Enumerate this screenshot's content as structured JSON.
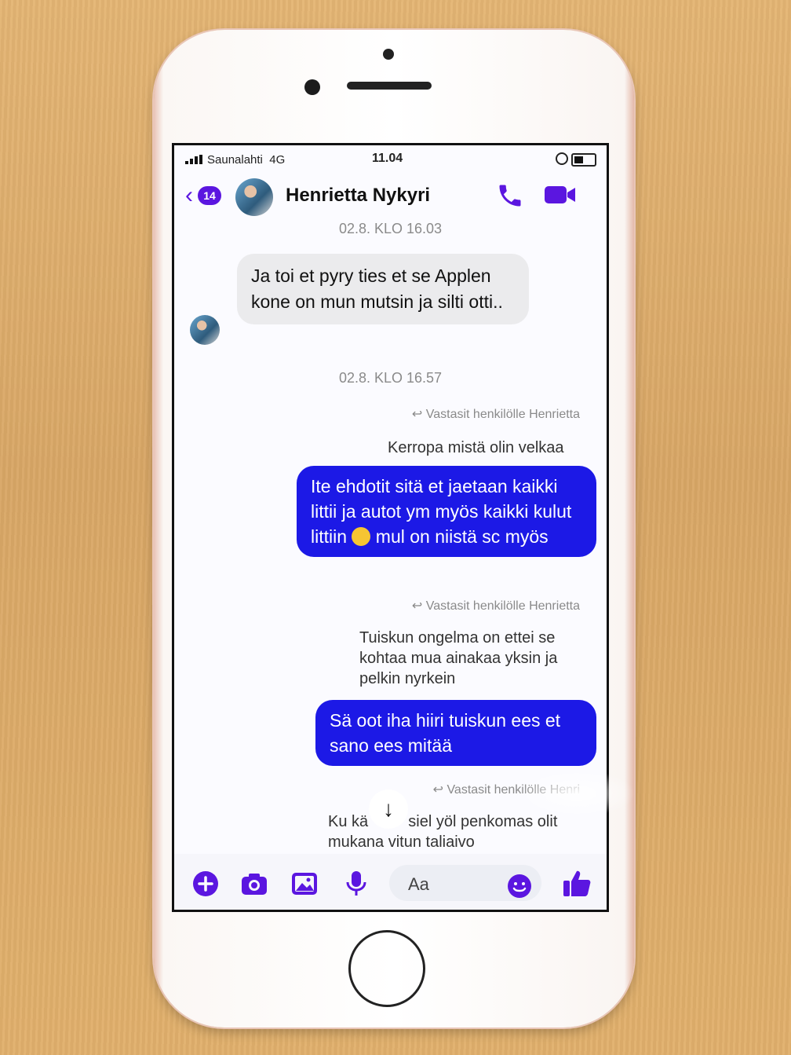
{
  "status_bar": {
    "carrier": "Saunalahti",
    "network": "4G",
    "time": "11.04"
  },
  "header": {
    "back_badge": "14",
    "contact_name": "Henrietta Nykyri"
  },
  "messages": {
    "timestamp_1": "02.8. KLO 16.03",
    "incoming_1": "Ja toi et pyry ties et se Applen kone on mun mutsin ja silti otti..",
    "timestamp_2": "02.8. KLO 16.57",
    "reply_note": "Vastasit henkilölle Henrietta",
    "quote_1": "Kerropa mistä olin velkaa",
    "outgoing_1_a": "Ite ehdotit sitä et jaetaan kaikki littii ja autot ym myös kaikki kulut littiin",
    "outgoing_1_b": "mul on niistä sc myös",
    "quote_2": "Tuiskun ongelma on ettei se kohtaa mua ainakaa yksin ja pelkin nyrkein",
    "outgoing_2": "Sä oot iha hiiri tuiskun ees et sano ees mitää",
    "reply_note_partial": "Vastasit henkilölle Henri",
    "quote_3_a": "Ku kä",
    "quote_3_b": "siel yöl penkomas olit mukana vitun taliaivo"
  },
  "composer": {
    "placeholder": "Aa"
  },
  "colors": {
    "accent": "#5b16e0",
    "outgoing_bubble": "#1c19e6",
    "incoming_bubble": "#ebebed"
  }
}
